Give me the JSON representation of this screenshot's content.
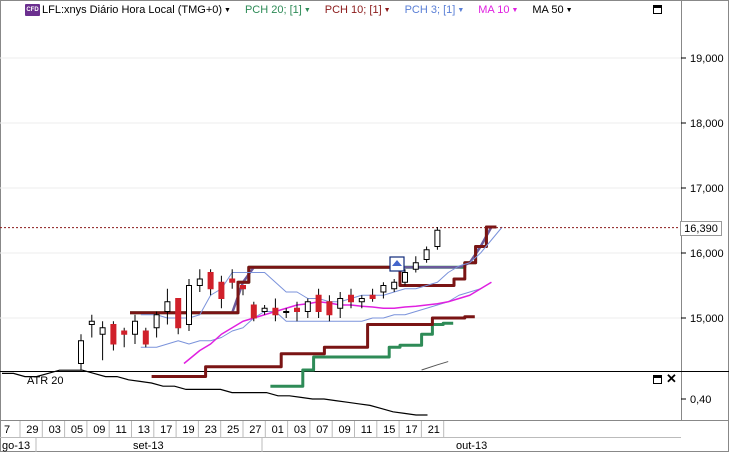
{
  "legend": {
    "cfd_badge": "CFD",
    "symbol": "LFL:xnys Diário Hora Local (TMG+0)",
    "indicators": [
      {
        "label": "PCH 20; [1]",
        "color": "#2e8b57"
      },
      {
        "label": "PCH 10; [1]",
        "color": "#8b1a1a"
      },
      {
        "label": "PCH 3; [1]",
        "color": "#5a7fd6"
      },
      {
        "label": "MA 10",
        "color": "#e020e0"
      },
      {
        "label": "MA 50",
        "color": "#000000"
      }
    ]
  },
  "price_axis": {
    "labels": [
      "19,000",
      "18,000",
      "17,000",
      "16,000",
      "15,000"
    ]
  },
  "current_price": "16,390",
  "atr_panel": {
    "label": "ATR 20",
    "axis_label": "0,40"
  },
  "time_axis": {
    "days": [
      "7",
      "29",
      "03",
      "05",
      "09",
      "11",
      "13",
      "17",
      "19",
      "23",
      "25",
      "27",
      "01",
      "03",
      "07",
      "09",
      "11",
      "15",
      "17",
      "21"
    ],
    "months": [
      "go-13",
      "set-13",
      "out-13"
    ]
  },
  "colors": {
    "up": "#ffffff",
    "down": "#d0202a",
    "dotted_line": "#8b1a1a"
  },
  "chart_data": {
    "type": "candlestick",
    "ylim": [
      14.2,
      20.0
    ],
    "current_price": 16.39,
    "candles": [
      {
        "o": 14.3,
        "h": 14.75,
        "l": 14.2,
        "c": 14.65
      },
      {
        "o": 14.9,
        "h": 15.05,
        "l": 14.7,
        "c": 14.95
      },
      {
        "o": 14.75,
        "h": 14.95,
        "l": 14.35,
        "c": 14.85
      },
      {
        "o": 14.9,
        "h": 14.95,
        "l": 14.5,
        "c": 14.6
      },
      {
        "o": 14.8,
        "h": 14.85,
        "l": 14.55,
        "c": 14.75
      },
      {
        "o": 14.75,
        "h": 15.05,
        "l": 14.6,
        "c": 14.95
      },
      {
        "o": 14.8,
        "h": 14.85,
        "l": 14.55,
        "c": 14.6
      },
      {
        "o": 14.85,
        "h": 15.1,
        "l": 14.7,
        "c": 15.05
      },
      {
        "o": 15.1,
        "h": 15.45,
        "l": 14.9,
        "c": 15.25
      },
      {
        "o": 15.3,
        "h": 14.95,
        "l": 14.75,
        "c": 14.85
      },
      {
        "o": 14.9,
        "h": 15.6,
        "l": 14.8,
        "c": 15.5
      },
      {
        "o": 15.5,
        "h": 15.75,
        "l": 15.4,
        "c": 15.6
      },
      {
        "o": 15.7,
        "h": 15.75,
        "l": 15.35,
        "c": 15.45
      },
      {
        "o": 15.55,
        "h": 15.65,
        "l": 15.15,
        "c": 15.3
      },
      {
        "o": 15.6,
        "h": 15.75,
        "l": 15.45,
        "c": 15.55
      },
      {
        "o": 15.5,
        "h": 15.5,
        "l": 15.35,
        "c": 15.45
      },
      {
        "o": 15.2,
        "h": 15.25,
        "l": 14.95,
        "c": 15.0
      },
      {
        "o": 15.1,
        "h": 15.2,
        "l": 15.05,
        "c": 15.15
      },
      {
        "o": 15.15,
        "h": 15.3,
        "l": 14.95,
        "c": 15.05
      },
      {
        "o": 15.1,
        "h": 15.15,
        "l": 15.0,
        "c": 15.1
      },
      {
        "o": 15.15,
        "h": 15.25,
        "l": 14.95,
        "c": 15.1
      },
      {
        "o": 15.1,
        "h": 15.3,
        "l": 15.0,
        "c": 15.25
      },
      {
        "o": 15.35,
        "h": 15.45,
        "l": 15.0,
        "c": 15.1
      },
      {
        "o": 15.25,
        "h": 15.35,
        "l": 14.95,
        "c": 15.05
      },
      {
        "o": 15.15,
        "h": 15.4,
        "l": 15.0,
        "c": 15.3
      },
      {
        "o": 15.35,
        "h": 15.45,
        "l": 15.15,
        "c": 15.25
      },
      {
        "o": 15.25,
        "h": 15.35,
        "l": 15.15,
        "c": 15.3
      },
      {
        "o": 15.35,
        "h": 15.45,
        "l": 15.25,
        "c": 15.3
      },
      {
        "o": 15.4,
        "h": 15.55,
        "l": 15.3,
        "c": 15.5
      },
      {
        "o": 15.45,
        "h": 15.6,
        "l": 15.4,
        "c": 15.55
      },
      {
        "o": 15.55,
        "h": 15.75,
        "l": 15.5,
        "c": 15.7
      },
      {
        "o": 15.75,
        "h": 15.95,
        "l": 15.7,
        "c": 15.85
      },
      {
        "o": 15.9,
        "h": 16.1,
        "l": 15.85,
        "c": 16.05
      },
      {
        "o": 16.1,
        "h": 16.4,
        "l": 16.05,
        "c": 16.35
      }
    ],
    "pch20_upper": {
      "start": 5,
      "values": [
        15.08,
        15.08,
        15.08,
        15.08,
        15.08,
        15.08,
        15.08,
        15.08,
        15.08,
        15.08,
        15.55,
        15.78,
        15.78,
        15.78,
        15.78,
        15.78,
        15.78,
        15.78,
        15.78,
        15.78,
        15.78,
        15.78,
        15.78,
        15.78,
        15.78,
        15.78,
        15.78,
        15.78,
        15.78,
        15.78,
        15.78,
        15.85,
        16.1,
        16.4
      ]
    },
    "pch20_lower": {
      "start": 18,
      "values": [
        13.95,
        13.95,
        13.95,
        14.2,
        14.4,
        14.4,
        14.4,
        14.4,
        14.4,
        14.4,
        14.4,
        14.55,
        14.58,
        14.58,
        14.75,
        14.9,
        14.92
      ]
    },
    "pch10_upper": {
      "start": 5,
      "values": [
        15.08,
        15.08,
        15.08,
        15.08,
        15.08,
        15.08,
        15.08,
        15.08,
        15.08,
        15.08,
        15.55,
        15.78,
        15.78,
        15.78,
        15.78,
        15.78,
        15.78,
        15.78,
        15.78,
        15.78,
        15.78,
        15.78,
        15.78,
        15.78,
        15.78,
        15.5,
        15.5,
        15.5,
        15.5,
        15.5,
        15.6,
        15.85,
        16.1,
        16.4
      ]
    },
    "pch10_lower": {
      "start": 7,
      "values": [
        14.1,
        14.1,
        14.1,
        14.1,
        14.1,
        14.25,
        14.25,
        14.25,
        14.25,
        14.25,
        14.25,
        14.25,
        14.45,
        14.45,
        14.45,
        14.45,
        14.55,
        14.55,
        14.55,
        14.55,
        14.9,
        14.9,
        14.9,
        14.9,
        14.9,
        14.9,
        15.0,
        15.0,
        15.0,
        15.02
      ]
    },
    "pch3_upper": {
      "start": 6,
      "values": [
        15.05,
        15.05,
        15.0,
        15.0,
        15.0,
        15.05,
        15.35,
        15.45,
        15.7,
        15.7,
        15.7,
        15.7,
        15.55,
        15.4,
        15.4,
        15.3,
        15.3,
        15.25,
        15.25,
        15.3,
        15.35,
        15.35,
        15.35,
        15.4,
        15.45,
        15.45,
        15.5,
        15.55,
        15.7,
        15.8,
        15.85,
        16.0,
        16.2,
        16.4
      ]
    },
    "pch3_lower": {
      "start": 6,
      "values": [
        14.55,
        14.55,
        14.6,
        14.65,
        14.6,
        14.65,
        14.65,
        14.7,
        14.8,
        14.85,
        15.0,
        15.1,
        15.1,
        14.95,
        14.95,
        14.95,
        14.95,
        14.95,
        14.95,
        14.95,
        14.95,
        15.0,
        15.0,
        15.05,
        15.05,
        15.1,
        15.15,
        15.2,
        15.25,
        15.35,
        15.4,
        15.45,
        15.55
      ]
    },
    "ma10": {
      "start": 10,
      "values": [
        14.3,
        14.5,
        14.6,
        14.75,
        14.85,
        14.95,
        15.0,
        15.05,
        15.1,
        15.15,
        15.2,
        15.22,
        15.25,
        15.23,
        15.2,
        15.2,
        15.18,
        15.17,
        15.15,
        15.15,
        15.17,
        15.18,
        15.2,
        15.22,
        15.25,
        15.3,
        15.35,
        15.45,
        15.55
      ]
    },
    "ma50": {
      "start": 32,
      "values": [
        14.2,
        14.28,
        14.33
      ]
    },
    "atr": {
      "start": 0,
      "ylim": [
        0.3,
        0.5
      ],
      "values": [
        0.48,
        0.48,
        0.47,
        0.47,
        0.48,
        0.49,
        0.49,
        0.49,
        0.48,
        0.47,
        0.47,
        0.46,
        0.455,
        0.45,
        0.44,
        0.44,
        0.43,
        0.43,
        0.43,
        0.43,
        0.42,
        0.42,
        0.42,
        0.42,
        0.41,
        0.41,
        0.405,
        0.4,
        0.4,
        0.395,
        0.39,
        0.385,
        0.38,
        0.37,
        0.36,
        0.355,
        0.35,
        0.35
      ]
    }
  }
}
